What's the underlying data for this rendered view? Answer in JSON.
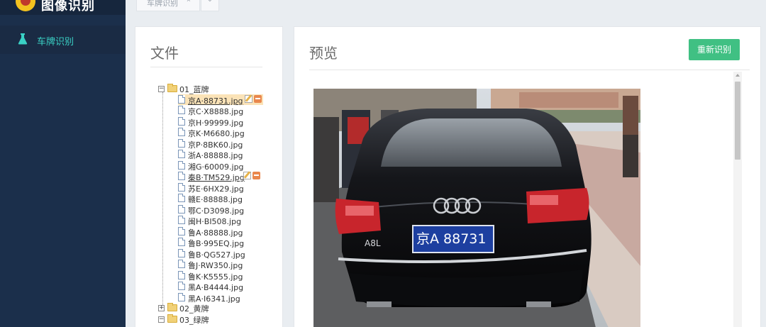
{
  "app": {
    "title": "图像识别"
  },
  "sidebar": {
    "items": [
      {
        "label": "车牌识别",
        "icon": "flask-icon"
      }
    ]
  },
  "tabs": [
    {
      "label": "车牌识别",
      "close": "×"
    }
  ],
  "tab_more_glyph": "⌄",
  "files_panel": {
    "heading": "文件",
    "folders": [
      {
        "name": "01_蓝牌",
        "expander": "−",
        "files": [
          "京A·88731.jpg",
          "京C·X8888.jpg",
          "京H·99999.jpg",
          "京K·M6680.jpg",
          "京P·8BK60.jpg",
          "浙A·88888.jpg",
          "湘G·60009.jpg",
          "秦B·TM529.jpg",
          "苏E·6HX29.jpg",
          "赣E·88888.jpg",
          "鄂C·D3098.jpg",
          "闽H·BI508.jpg",
          "鲁A·88888.jpg",
          "鲁B·995EQ.jpg",
          "鲁B·QG527.jpg",
          "鲁J·RW350.jpg",
          "鲁K·K5555.jpg",
          "黑A·B4444.jpg",
          "黑A·I6341.jpg"
        ]
      },
      {
        "name": "02_黄牌",
        "expander": "+"
      },
      {
        "name": "03_绿牌",
        "expander": "−"
      }
    ]
  },
  "preview_panel": {
    "heading": "预览",
    "button_label": "重新识别",
    "plate_text": "京A 88731",
    "car_badge": "A8L"
  },
  "colors": {
    "sidebar": "#1b2f4b",
    "accent_nav": "#3ad1c5",
    "button": "#40c083",
    "selected_file": "#fbe3b7"
  }
}
